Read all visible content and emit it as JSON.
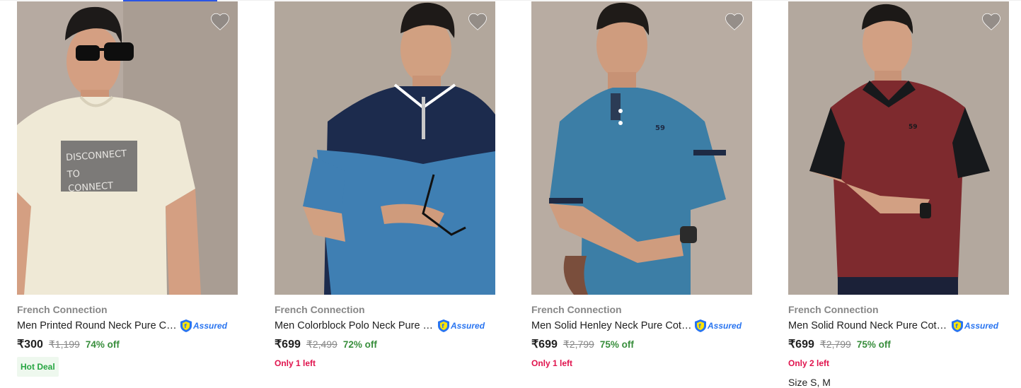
{
  "products": [
    {
      "brand": "French Connection",
      "title": "Men Printed Round Neck Pure Cotton T-shirt",
      "assured": "Assured",
      "price": "₹300",
      "mrp": "₹1,199",
      "discount": "74% off",
      "badge": "Hot Deal",
      "image_text": [
        "DISCONNECT",
        "TO",
        "CONNECT"
      ],
      "colors": {
        "bg": "#b6aaa1",
        "shirt": "#efe9d6",
        "skin": "#d49f82"
      }
    },
    {
      "brand": "French Connection",
      "title": "Men Colorblock Polo Neck Pure Cotton T-shirt",
      "assured": "Assured",
      "price": "₹699",
      "mrp": "₹2,499",
      "discount": "72% off",
      "stock": "Only 1 left",
      "colors": {
        "bg": "#b2a79c",
        "shirt_top": "#1c2b4d",
        "shirt": "#3f7fb3",
        "skin": "#d1a081"
      }
    },
    {
      "brand": "French Connection",
      "title": "Men Solid Henley Neck Pure Cotton T-shirt",
      "assured": "Assured",
      "price": "₹699",
      "mrp": "₹2,799",
      "discount": "75% off",
      "stock": "Only 1 left",
      "colors": {
        "bg": "#b8aca2",
        "shirt": "#3c7ea6",
        "skin": "#cf9c7e"
      }
    },
    {
      "brand": "French Connection",
      "title": "Men Solid Round Neck Pure Cotton T-shirt",
      "assured": "Assured",
      "price": "₹699",
      "mrp": "₹2,799",
      "discount": "75% off",
      "stock": "Only 2 left",
      "sizes": "Size S, M",
      "colors": {
        "bg": "#b3a89e",
        "shirt": "#7e2a2e",
        "sleeve": "#17191c",
        "skin": "#d2a083"
      }
    }
  ],
  "icons": {
    "wishlist": "heart-icon",
    "assured": "assured-shield-icon"
  },
  "theme": {
    "assured_blue": "#2874f0",
    "discount_green": "#388e3c",
    "stock_red": "#e0134d",
    "hotdeal_bg": "#eef8ee"
  }
}
